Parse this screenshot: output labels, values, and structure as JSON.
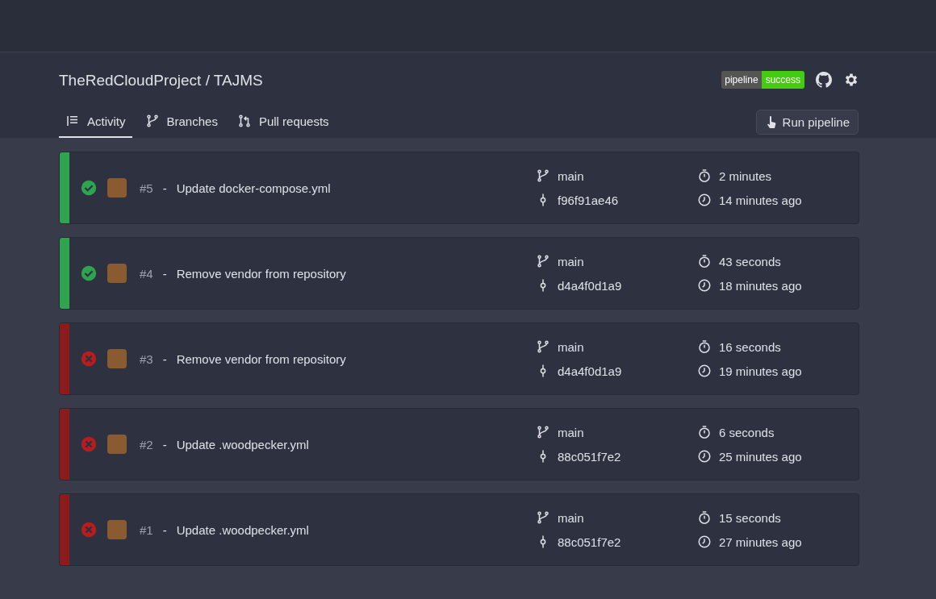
{
  "repo": {
    "title": "TheRedCloudProject / TAJMS"
  },
  "badge": {
    "label": "pipeline",
    "value": "success"
  },
  "tabs": [
    {
      "label": "Activity",
      "selected": true
    },
    {
      "label": "Branches",
      "selected": false
    },
    {
      "label": "Pull requests",
      "selected": false
    }
  ],
  "run_button": {
    "label": "Run pipeline"
  },
  "pipelines": [
    {
      "passed": true,
      "number": "#5",
      "separator": "-",
      "message": "Update docker-compose.yml",
      "branch": "main",
      "commit": "f96f91ae46",
      "duration": "2 minutes",
      "time": "14 minutes ago"
    },
    {
      "passed": true,
      "number": "#4",
      "separator": "-",
      "message": "Remove vendor from repository",
      "branch": "main",
      "commit": "d4a4f0d1a9",
      "duration": "43 seconds",
      "time": "18 minutes ago"
    },
    {
      "passed": false,
      "number": "#3",
      "separator": "-",
      "message": "Remove vendor from repository",
      "branch": "main",
      "commit": "d4a4f0d1a9",
      "duration": "16 seconds",
      "time": "19 minutes ago"
    },
    {
      "passed": false,
      "number": "#2",
      "separator": "-",
      "message": "Update .woodpecker.yml",
      "branch": "main",
      "commit": "88c051f7e2",
      "duration": "6 seconds",
      "time": "25 minutes ago"
    },
    {
      "passed": false,
      "number": "#1",
      "separator": "-",
      "message": "Update .woodpecker.yml",
      "branch": "main",
      "commit": "88c051f7e2",
      "duration": "15 seconds",
      "time": "27 minutes ago"
    }
  ]
}
